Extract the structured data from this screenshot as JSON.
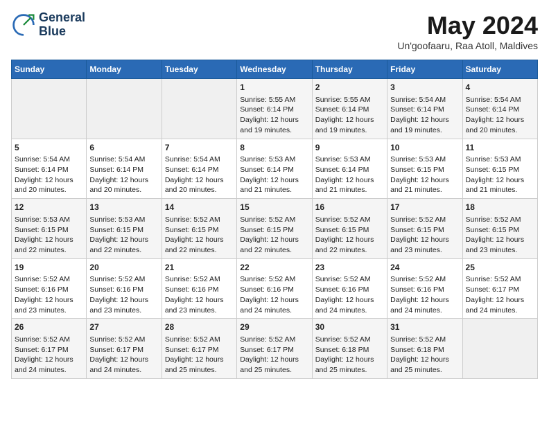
{
  "header": {
    "logo_line1": "General",
    "logo_line2": "Blue",
    "month": "May 2024",
    "location": "Un'goofaaru, Raa Atoll, Maldives"
  },
  "days_of_week": [
    "Sunday",
    "Monday",
    "Tuesday",
    "Wednesday",
    "Thursday",
    "Friday",
    "Saturday"
  ],
  "weeks": [
    [
      {
        "day": "",
        "empty": true
      },
      {
        "day": "",
        "empty": true
      },
      {
        "day": "",
        "empty": true
      },
      {
        "day": "1",
        "sunrise": "5:55 AM",
        "sunset": "6:14 PM",
        "daylight": "12 hours and 19 minutes."
      },
      {
        "day": "2",
        "sunrise": "5:55 AM",
        "sunset": "6:14 PM",
        "daylight": "12 hours and 19 minutes."
      },
      {
        "day": "3",
        "sunrise": "5:54 AM",
        "sunset": "6:14 PM",
        "daylight": "12 hours and 19 minutes."
      },
      {
        "day": "4",
        "sunrise": "5:54 AM",
        "sunset": "6:14 PM",
        "daylight": "12 hours and 20 minutes."
      }
    ],
    [
      {
        "day": "5",
        "sunrise": "5:54 AM",
        "sunset": "6:14 PM",
        "daylight": "12 hours and 20 minutes."
      },
      {
        "day": "6",
        "sunrise": "5:54 AM",
        "sunset": "6:14 PM",
        "daylight": "12 hours and 20 minutes."
      },
      {
        "day": "7",
        "sunrise": "5:54 AM",
        "sunset": "6:14 PM",
        "daylight": "12 hours and 20 minutes."
      },
      {
        "day": "8",
        "sunrise": "5:53 AM",
        "sunset": "6:14 PM",
        "daylight": "12 hours and 21 minutes."
      },
      {
        "day": "9",
        "sunrise": "5:53 AM",
        "sunset": "6:14 PM",
        "daylight": "12 hours and 21 minutes."
      },
      {
        "day": "10",
        "sunrise": "5:53 AM",
        "sunset": "6:15 PM",
        "daylight": "12 hours and 21 minutes."
      },
      {
        "day": "11",
        "sunrise": "5:53 AM",
        "sunset": "6:15 PM",
        "daylight": "12 hours and 21 minutes."
      }
    ],
    [
      {
        "day": "12",
        "sunrise": "5:53 AM",
        "sunset": "6:15 PM",
        "daylight": "12 hours and 22 minutes."
      },
      {
        "day": "13",
        "sunrise": "5:53 AM",
        "sunset": "6:15 PM",
        "daylight": "12 hours and 22 minutes."
      },
      {
        "day": "14",
        "sunrise": "5:52 AM",
        "sunset": "6:15 PM",
        "daylight": "12 hours and 22 minutes."
      },
      {
        "day": "15",
        "sunrise": "5:52 AM",
        "sunset": "6:15 PM",
        "daylight": "12 hours and 22 minutes."
      },
      {
        "day": "16",
        "sunrise": "5:52 AM",
        "sunset": "6:15 PM",
        "daylight": "12 hours and 22 minutes."
      },
      {
        "day": "17",
        "sunrise": "5:52 AM",
        "sunset": "6:15 PM",
        "daylight": "12 hours and 23 minutes."
      },
      {
        "day": "18",
        "sunrise": "5:52 AM",
        "sunset": "6:15 PM",
        "daylight": "12 hours and 23 minutes."
      }
    ],
    [
      {
        "day": "19",
        "sunrise": "5:52 AM",
        "sunset": "6:16 PM",
        "daylight": "12 hours and 23 minutes."
      },
      {
        "day": "20",
        "sunrise": "5:52 AM",
        "sunset": "6:16 PM",
        "daylight": "12 hours and 23 minutes."
      },
      {
        "day": "21",
        "sunrise": "5:52 AM",
        "sunset": "6:16 PM",
        "daylight": "12 hours and 23 minutes."
      },
      {
        "day": "22",
        "sunrise": "5:52 AM",
        "sunset": "6:16 PM",
        "daylight": "12 hours and 24 minutes."
      },
      {
        "day": "23",
        "sunrise": "5:52 AM",
        "sunset": "6:16 PM",
        "daylight": "12 hours and 24 minutes."
      },
      {
        "day": "24",
        "sunrise": "5:52 AM",
        "sunset": "6:16 PM",
        "daylight": "12 hours and 24 minutes."
      },
      {
        "day": "25",
        "sunrise": "5:52 AM",
        "sunset": "6:17 PM",
        "daylight": "12 hours and 24 minutes."
      }
    ],
    [
      {
        "day": "26",
        "sunrise": "5:52 AM",
        "sunset": "6:17 PM",
        "daylight": "12 hours and 24 minutes."
      },
      {
        "day": "27",
        "sunrise": "5:52 AM",
        "sunset": "6:17 PM",
        "daylight": "12 hours and 24 minutes."
      },
      {
        "day": "28",
        "sunrise": "5:52 AM",
        "sunset": "6:17 PM",
        "daylight": "12 hours and 25 minutes."
      },
      {
        "day": "29",
        "sunrise": "5:52 AM",
        "sunset": "6:17 PM",
        "daylight": "12 hours and 25 minutes."
      },
      {
        "day": "30",
        "sunrise": "5:52 AM",
        "sunset": "6:18 PM",
        "daylight": "12 hours and 25 minutes."
      },
      {
        "day": "31",
        "sunrise": "5:52 AM",
        "sunset": "6:18 PM",
        "daylight": "12 hours and 25 minutes."
      },
      {
        "day": "",
        "empty": true
      }
    ]
  ]
}
